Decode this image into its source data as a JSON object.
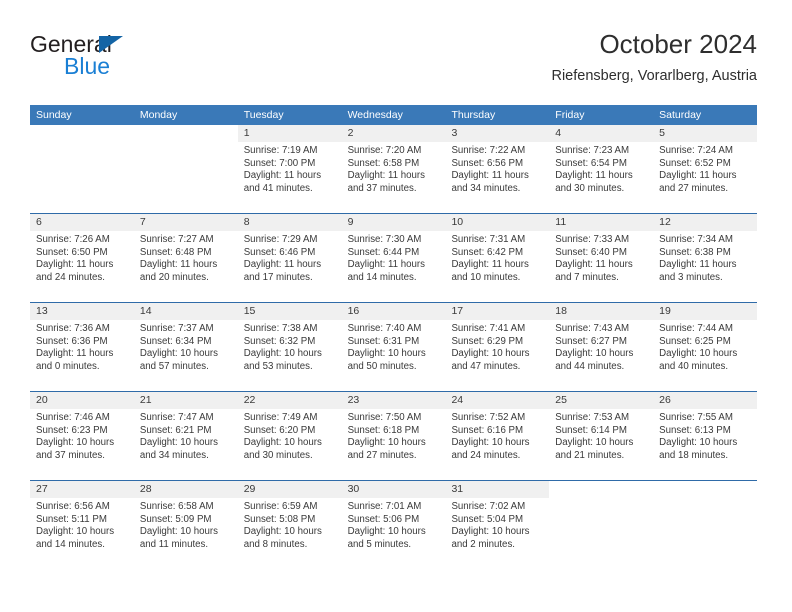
{
  "brand": {
    "word_one": "General",
    "word_two": "Blue",
    "icon": "triangle-logo"
  },
  "header": {
    "title": "October 2024",
    "subtitle": "Riefensberg, Vorarlberg, Austria"
  },
  "theme": {
    "header_blue": "#3a79b8",
    "separator_blue": "#2f6ba8",
    "date_band_gray": "#f0f0f0",
    "brand_blue": "#1a7fd4",
    "text_dark": "#3a3a3a"
  },
  "weekdays": [
    "Sunday",
    "Monday",
    "Tuesday",
    "Wednesday",
    "Thursday",
    "Friday",
    "Saturday"
  ],
  "weeks": [
    [
      {
        "empty": true
      },
      {
        "empty": true
      },
      {
        "date": "1",
        "sunrise": "Sunrise: 7:19 AM",
        "sunset": "Sunset: 7:00 PM",
        "daylight_1": "Daylight: 11 hours",
        "daylight_2": "and 41 minutes."
      },
      {
        "date": "2",
        "sunrise": "Sunrise: 7:20 AM",
        "sunset": "Sunset: 6:58 PM",
        "daylight_1": "Daylight: 11 hours",
        "daylight_2": "and 37 minutes."
      },
      {
        "date": "3",
        "sunrise": "Sunrise: 7:22 AM",
        "sunset": "Sunset: 6:56 PM",
        "daylight_1": "Daylight: 11 hours",
        "daylight_2": "and 34 minutes."
      },
      {
        "date": "4",
        "sunrise": "Sunrise: 7:23 AM",
        "sunset": "Sunset: 6:54 PM",
        "daylight_1": "Daylight: 11 hours",
        "daylight_2": "and 30 minutes."
      },
      {
        "date": "5",
        "sunrise": "Sunrise: 7:24 AM",
        "sunset": "Sunset: 6:52 PM",
        "daylight_1": "Daylight: 11 hours",
        "daylight_2": "and 27 minutes."
      }
    ],
    [
      {
        "date": "6",
        "sunrise": "Sunrise: 7:26 AM",
        "sunset": "Sunset: 6:50 PM",
        "daylight_1": "Daylight: 11 hours",
        "daylight_2": "and 24 minutes."
      },
      {
        "date": "7",
        "sunrise": "Sunrise: 7:27 AM",
        "sunset": "Sunset: 6:48 PM",
        "daylight_1": "Daylight: 11 hours",
        "daylight_2": "and 20 minutes."
      },
      {
        "date": "8",
        "sunrise": "Sunrise: 7:29 AM",
        "sunset": "Sunset: 6:46 PM",
        "daylight_1": "Daylight: 11 hours",
        "daylight_2": "and 17 minutes."
      },
      {
        "date": "9",
        "sunrise": "Sunrise: 7:30 AM",
        "sunset": "Sunset: 6:44 PM",
        "daylight_1": "Daylight: 11 hours",
        "daylight_2": "and 14 minutes."
      },
      {
        "date": "10",
        "sunrise": "Sunrise: 7:31 AM",
        "sunset": "Sunset: 6:42 PM",
        "daylight_1": "Daylight: 11 hours",
        "daylight_2": "and 10 minutes."
      },
      {
        "date": "11",
        "sunrise": "Sunrise: 7:33 AM",
        "sunset": "Sunset: 6:40 PM",
        "daylight_1": "Daylight: 11 hours",
        "daylight_2": "and 7 minutes."
      },
      {
        "date": "12",
        "sunrise": "Sunrise: 7:34 AM",
        "sunset": "Sunset: 6:38 PM",
        "daylight_1": "Daylight: 11 hours",
        "daylight_2": "and 3 minutes."
      }
    ],
    [
      {
        "date": "13",
        "sunrise": "Sunrise: 7:36 AM",
        "sunset": "Sunset: 6:36 PM",
        "daylight_1": "Daylight: 11 hours",
        "daylight_2": "and 0 minutes."
      },
      {
        "date": "14",
        "sunrise": "Sunrise: 7:37 AM",
        "sunset": "Sunset: 6:34 PM",
        "daylight_1": "Daylight: 10 hours",
        "daylight_2": "and 57 minutes."
      },
      {
        "date": "15",
        "sunrise": "Sunrise: 7:38 AM",
        "sunset": "Sunset: 6:32 PM",
        "daylight_1": "Daylight: 10 hours",
        "daylight_2": "and 53 minutes."
      },
      {
        "date": "16",
        "sunrise": "Sunrise: 7:40 AM",
        "sunset": "Sunset: 6:31 PM",
        "daylight_1": "Daylight: 10 hours",
        "daylight_2": "and 50 minutes."
      },
      {
        "date": "17",
        "sunrise": "Sunrise: 7:41 AM",
        "sunset": "Sunset: 6:29 PM",
        "daylight_1": "Daylight: 10 hours",
        "daylight_2": "and 47 minutes."
      },
      {
        "date": "18",
        "sunrise": "Sunrise: 7:43 AM",
        "sunset": "Sunset: 6:27 PM",
        "daylight_1": "Daylight: 10 hours",
        "daylight_2": "and 44 minutes."
      },
      {
        "date": "19",
        "sunrise": "Sunrise: 7:44 AM",
        "sunset": "Sunset: 6:25 PM",
        "daylight_1": "Daylight: 10 hours",
        "daylight_2": "and 40 minutes."
      }
    ],
    [
      {
        "date": "20",
        "sunrise": "Sunrise: 7:46 AM",
        "sunset": "Sunset: 6:23 PM",
        "daylight_1": "Daylight: 10 hours",
        "daylight_2": "and 37 minutes."
      },
      {
        "date": "21",
        "sunrise": "Sunrise: 7:47 AM",
        "sunset": "Sunset: 6:21 PM",
        "daylight_1": "Daylight: 10 hours",
        "daylight_2": "and 34 minutes."
      },
      {
        "date": "22",
        "sunrise": "Sunrise: 7:49 AM",
        "sunset": "Sunset: 6:20 PM",
        "daylight_1": "Daylight: 10 hours",
        "daylight_2": "and 30 minutes."
      },
      {
        "date": "23",
        "sunrise": "Sunrise: 7:50 AM",
        "sunset": "Sunset: 6:18 PM",
        "daylight_1": "Daylight: 10 hours",
        "daylight_2": "and 27 minutes."
      },
      {
        "date": "24",
        "sunrise": "Sunrise: 7:52 AM",
        "sunset": "Sunset: 6:16 PM",
        "daylight_1": "Daylight: 10 hours",
        "daylight_2": "and 24 minutes."
      },
      {
        "date": "25",
        "sunrise": "Sunrise: 7:53 AM",
        "sunset": "Sunset: 6:14 PM",
        "daylight_1": "Daylight: 10 hours",
        "daylight_2": "and 21 minutes."
      },
      {
        "date": "26",
        "sunrise": "Sunrise: 7:55 AM",
        "sunset": "Sunset: 6:13 PM",
        "daylight_1": "Daylight: 10 hours",
        "daylight_2": "and 18 minutes."
      }
    ],
    [
      {
        "date": "27",
        "sunrise": "Sunrise: 6:56 AM",
        "sunset": "Sunset: 5:11 PM",
        "daylight_1": "Daylight: 10 hours",
        "daylight_2": "and 14 minutes."
      },
      {
        "date": "28",
        "sunrise": "Sunrise: 6:58 AM",
        "sunset": "Sunset: 5:09 PM",
        "daylight_1": "Daylight: 10 hours",
        "daylight_2": "and 11 minutes."
      },
      {
        "date": "29",
        "sunrise": "Sunrise: 6:59 AM",
        "sunset": "Sunset: 5:08 PM",
        "daylight_1": "Daylight: 10 hours",
        "daylight_2": "and 8 minutes."
      },
      {
        "date": "30",
        "sunrise": "Sunrise: 7:01 AM",
        "sunset": "Sunset: 5:06 PM",
        "daylight_1": "Daylight: 10 hours",
        "daylight_2": "and 5 minutes."
      },
      {
        "date": "31",
        "sunrise": "Sunrise: 7:02 AM",
        "sunset": "Sunset: 5:04 PM",
        "daylight_1": "Daylight: 10 hours",
        "daylight_2": "and 2 minutes."
      },
      {
        "empty": true
      },
      {
        "empty": true
      }
    ]
  ]
}
